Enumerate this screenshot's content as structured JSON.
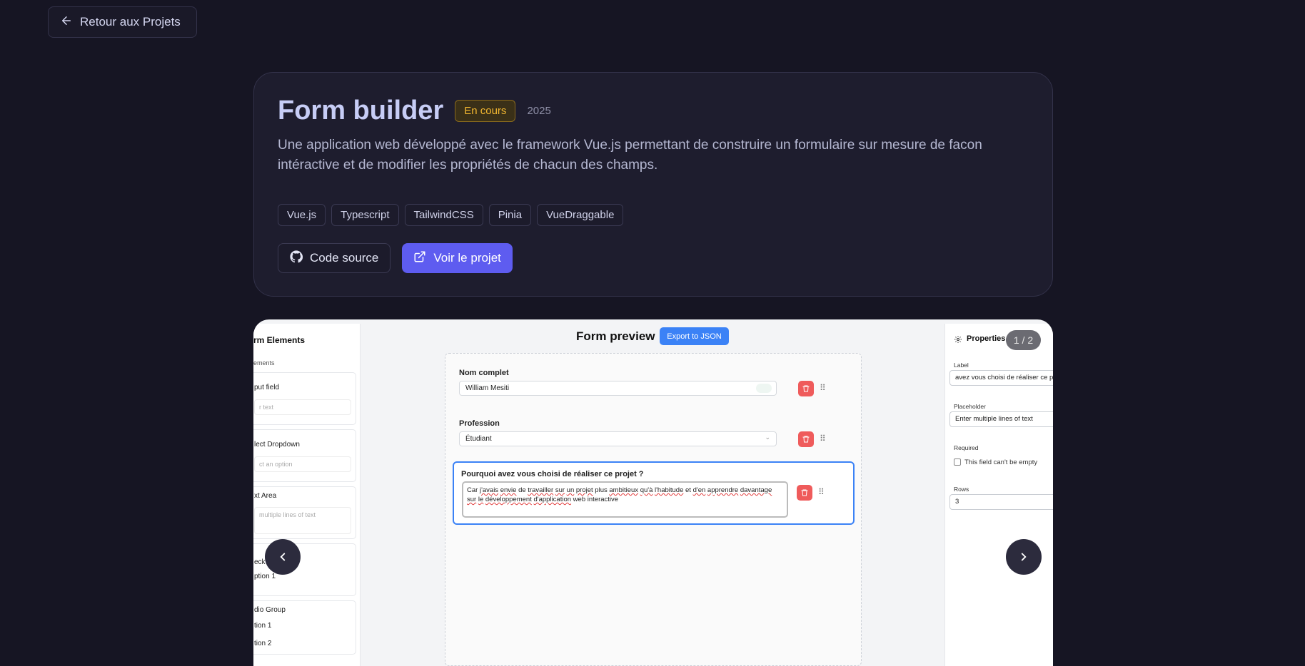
{
  "back": {
    "label": "Retour aux Projets"
  },
  "project": {
    "title": "Form builder",
    "status": "En cours",
    "year": "2025",
    "description": "Une application web développé avec le framework Vue.js permettant de construire un formulaire sur mesure de facon intéractive et de modifier les propriétés de chacun des champs.",
    "tags": [
      "Vue.js",
      "Typescript",
      "TailwindCSS",
      "Pinia",
      "VueDraggable"
    ],
    "source_label": "Code source",
    "view_label": "Voir le projet"
  },
  "colors": {
    "background": "#161523",
    "accent": "#5e5cf0",
    "badge": "#f2b730",
    "danger": "#ef5b5b",
    "primary_blue": "#3b82f6"
  },
  "carousel": {
    "counter": "1 / 2",
    "screenshot": {
      "left_panel": {
        "title": "rm Elements",
        "subtitle": "ements",
        "items": [
          {
            "label": "put field",
            "placeholder": "r text"
          },
          {
            "label": "lect Dropdown",
            "placeholder": "ct an option"
          },
          {
            "label": "xt Area",
            "placeholder": "multiple lines of text"
          },
          {
            "label": "eck",
            "option": "ption 1"
          },
          {
            "label": "dio Group",
            "option1": "tion 1",
            "option2": "tion 2"
          }
        ]
      },
      "center": {
        "title": "Form preview",
        "export_label": "Export to JSON",
        "fields": [
          {
            "label": "Nom complet",
            "value": "William Mesiti"
          },
          {
            "label": "Profession",
            "value": "Étudiant"
          },
          {
            "label": "Pourquoi avez vous choisi de réaliser ce projet ?"
          }
        ],
        "textarea_words": [
          "Car",
          "j'avais",
          "envie",
          "de",
          "travailler",
          "sur",
          "un",
          "projet",
          "plus",
          "ambitieux",
          "qu'à",
          "l'habitude",
          "et",
          "d'en",
          "apprendre",
          "davantage",
          "sur",
          "le",
          "développement",
          "d'application",
          "web",
          "interactive"
        ]
      },
      "right_panel": {
        "title": "Properties",
        "label_label": "Label",
        "label_value": "avez vous choisi de réaliser ce pr",
        "placeholder_label": "Placeholder",
        "placeholder_value": "Enter multiple lines of text",
        "required_label": "Required",
        "required_text": "This field can't be empty",
        "rows_label": "Rows",
        "rows_value": "3"
      }
    }
  }
}
